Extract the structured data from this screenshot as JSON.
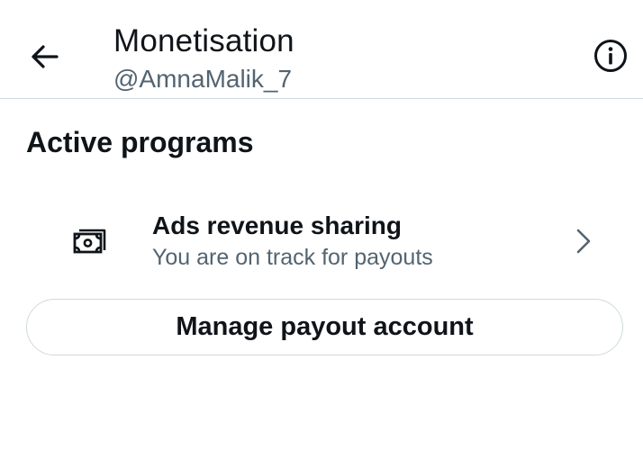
{
  "header": {
    "title": "Monetisation",
    "handle": "@AmnaMalik_7",
    "back_icon": "arrow-left-icon",
    "info_icon": "info-circle-icon"
  },
  "section": {
    "heading": "Active programs"
  },
  "program": {
    "icon": "money-icon",
    "title": "Ads revenue sharing",
    "subtitle": "You are on track for payouts",
    "chevron_icon": "chevron-right-icon"
  },
  "actions": {
    "manage_payout_label": "Manage payout account"
  },
  "colors": {
    "text_primary": "#0f1419",
    "text_secondary": "#536471",
    "border": "#cfd9de",
    "background": "#ffffff"
  }
}
